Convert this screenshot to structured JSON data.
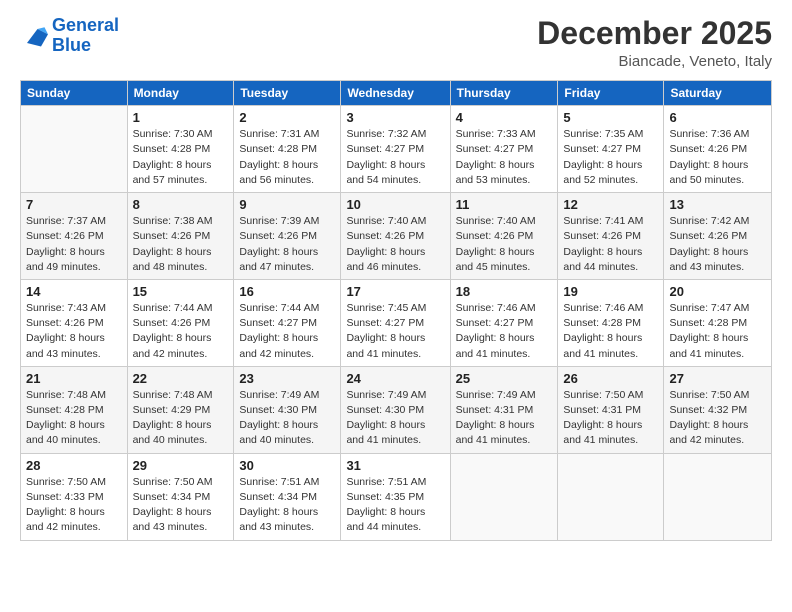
{
  "header": {
    "logo_line1": "General",
    "logo_line2": "Blue",
    "month_title": "December 2025",
    "location": "Biancade, Veneto, Italy"
  },
  "days_of_week": [
    "Sunday",
    "Monday",
    "Tuesday",
    "Wednesday",
    "Thursday",
    "Friday",
    "Saturday"
  ],
  "weeks": [
    [
      {
        "day": "",
        "sunrise": "",
        "sunset": "",
        "daylight": ""
      },
      {
        "day": "1",
        "sunrise": "Sunrise: 7:30 AM",
        "sunset": "Sunset: 4:28 PM",
        "daylight": "Daylight: 8 hours and 57 minutes."
      },
      {
        "day": "2",
        "sunrise": "Sunrise: 7:31 AM",
        "sunset": "Sunset: 4:28 PM",
        "daylight": "Daylight: 8 hours and 56 minutes."
      },
      {
        "day": "3",
        "sunrise": "Sunrise: 7:32 AM",
        "sunset": "Sunset: 4:27 PM",
        "daylight": "Daylight: 8 hours and 54 minutes."
      },
      {
        "day": "4",
        "sunrise": "Sunrise: 7:33 AM",
        "sunset": "Sunset: 4:27 PM",
        "daylight": "Daylight: 8 hours and 53 minutes."
      },
      {
        "day": "5",
        "sunrise": "Sunrise: 7:35 AM",
        "sunset": "Sunset: 4:27 PM",
        "daylight": "Daylight: 8 hours and 52 minutes."
      },
      {
        "day": "6",
        "sunrise": "Sunrise: 7:36 AM",
        "sunset": "Sunset: 4:26 PM",
        "daylight": "Daylight: 8 hours and 50 minutes."
      }
    ],
    [
      {
        "day": "7",
        "sunrise": "Sunrise: 7:37 AM",
        "sunset": "Sunset: 4:26 PM",
        "daylight": "Daylight: 8 hours and 49 minutes."
      },
      {
        "day": "8",
        "sunrise": "Sunrise: 7:38 AM",
        "sunset": "Sunset: 4:26 PM",
        "daylight": "Daylight: 8 hours and 48 minutes."
      },
      {
        "day": "9",
        "sunrise": "Sunrise: 7:39 AM",
        "sunset": "Sunset: 4:26 PM",
        "daylight": "Daylight: 8 hours and 47 minutes."
      },
      {
        "day": "10",
        "sunrise": "Sunrise: 7:40 AM",
        "sunset": "Sunset: 4:26 PM",
        "daylight": "Daylight: 8 hours and 46 minutes."
      },
      {
        "day": "11",
        "sunrise": "Sunrise: 7:40 AM",
        "sunset": "Sunset: 4:26 PM",
        "daylight": "Daylight: 8 hours and 45 minutes."
      },
      {
        "day": "12",
        "sunrise": "Sunrise: 7:41 AM",
        "sunset": "Sunset: 4:26 PM",
        "daylight": "Daylight: 8 hours and 44 minutes."
      },
      {
        "day": "13",
        "sunrise": "Sunrise: 7:42 AM",
        "sunset": "Sunset: 4:26 PM",
        "daylight": "Daylight: 8 hours and 43 minutes."
      }
    ],
    [
      {
        "day": "14",
        "sunrise": "Sunrise: 7:43 AM",
        "sunset": "Sunset: 4:26 PM",
        "daylight": "Daylight: 8 hours and 43 minutes."
      },
      {
        "day": "15",
        "sunrise": "Sunrise: 7:44 AM",
        "sunset": "Sunset: 4:26 PM",
        "daylight": "Daylight: 8 hours and 42 minutes."
      },
      {
        "day": "16",
        "sunrise": "Sunrise: 7:44 AM",
        "sunset": "Sunset: 4:27 PM",
        "daylight": "Daylight: 8 hours and 42 minutes."
      },
      {
        "day": "17",
        "sunrise": "Sunrise: 7:45 AM",
        "sunset": "Sunset: 4:27 PM",
        "daylight": "Daylight: 8 hours and 41 minutes."
      },
      {
        "day": "18",
        "sunrise": "Sunrise: 7:46 AM",
        "sunset": "Sunset: 4:27 PM",
        "daylight": "Daylight: 8 hours and 41 minutes."
      },
      {
        "day": "19",
        "sunrise": "Sunrise: 7:46 AM",
        "sunset": "Sunset: 4:28 PM",
        "daylight": "Daylight: 8 hours and 41 minutes."
      },
      {
        "day": "20",
        "sunrise": "Sunrise: 7:47 AM",
        "sunset": "Sunset: 4:28 PM",
        "daylight": "Daylight: 8 hours and 41 minutes."
      }
    ],
    [
      {
        "day": "21",
        "sunrise": "Sunrise: 7:48 AM",
        "sunset": "Sunset: 4:28 PM",
        "daylight": "Daylight: 8 hours and 40 minutes."
      },
      {
        "day": "22",
        "sunrise": "Sunrise: 7:48 AM",
        "sunset": "Sunset: 4:29 PM",
        "daylight": "Daylight: 8 hours and 40 minutes."
      },
      {
        "day": "23",
        "sunrise": "Sunrise: 7:49 AM",
        "sunset": "Sunset: 4:30 PM",
        "daylight": "Daylight: 8 hours and 40 minutes."
      },
      {
        "day": "24",
        "sunrise": "Sunrise: 7:49 AM",
        "sunset": "Sunset: 4:30 PM",
        "daylight": "Daylight: 8 hours and 41 minutes."
      },
      {
        "day": "25",
        "sunrise": "Sunrise: 7:49 AM",
        "sunset": "Sunset: 4:31 PM",
        "daylight": "Daylight: 8 hours and 41 minutes."
      },
      {
        "day": "26",
        "sunrise": "Sunrise: 7:50 AM",
        "sunset": "Sunset: 4:31 PM",
        "daylight": "Daylight: 8 hours and 41 minutes."
      },
      {
        "day": "27",
        "sunrise": "Sunrise: 7:50 AM",
        "sunset": "Sunset: 4:32 PM",
        "daylight": "Daylight: 8 hours and 42 minutes."
      }
    ],
    [
      {
        "day": "28",
        "sunrise": "Sunrise: 7:50 AM",
        "sunset": "Sunset: 4:33 PM",
        "daylight": "Daylight: 8 hours and 42 minutes."
      },
      {
        "day": "29",
        "sunrise": "Sunrise: 7:50 AM",
        "sunset": "Sunset: 4:34 PM",
        "daylight": "Daylight: 8 hours and 43 minutes."
      },
      {
        "day": "30",
        "sunrise": "Sunrise: 7:51 AM",
        "sunset": "Sunset: 4:34 PM",
        "daylight": "Daylight: 8 hours and 43 minutes."
      },
      {
        "day": "31",
        "sunrise": "Sunrise: 7:51 AM",
        "sunset": "Sunset: 4:35 PM",
        "daylight": "Daylight: 8 hours and 44 minutes."
      },
      {
        "day": "",
        "sunrise": "",
        "sunset": "",
        "daylight": ""
      },
      {
        "day": "",
        "sunrise": "",
        "sunset": "",
        "daylight": ""
      },
      {
        "day": "",
        "sunrise": "",
        "sunset": "",
        "daylight": ""
      }
    ]
  ]
}
